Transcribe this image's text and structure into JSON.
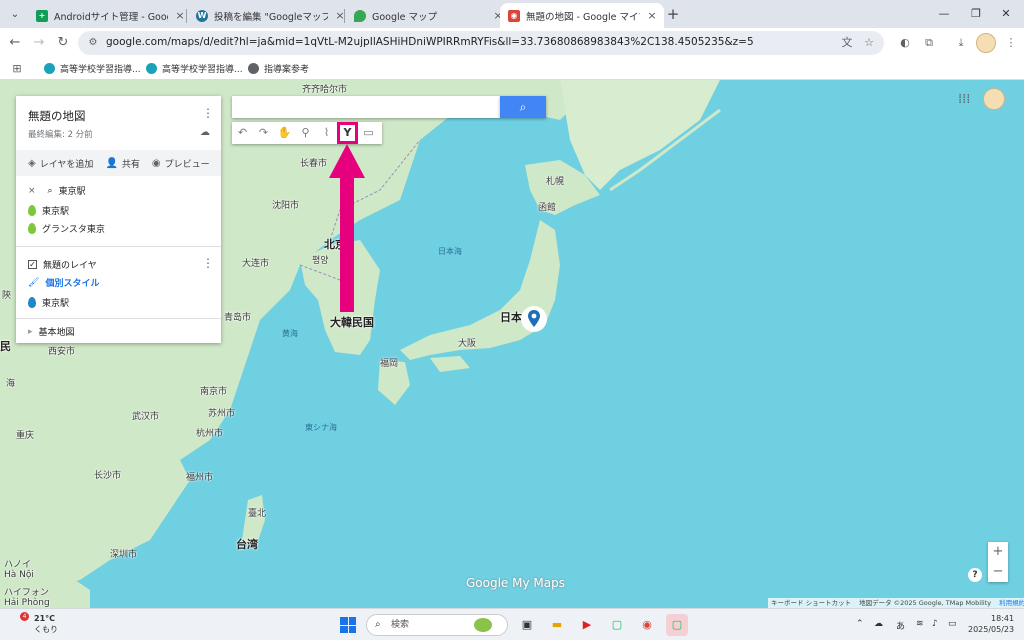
{
  "browser": {
    "tabs": [
      {
        "title": "Androidサイト管理 - Google スプ",
        "icon_color": "#0f9d58",
        "icon": "sheets-icon"
      },
      {
        "title": "投稿を編集 \"Googleマップのルート",
        "icon_color": "#21759b",
        "icon": "wordpress-icon"
      },
      {
        "title": "Google マップ",
        "icon_color": "#34a853",
        "icon": "maps-icon"
      },
      {
        "title": "無題の地図 - Google マイマップ",
        "icon_color": "#db4437",
        "icon": "mymaps-icon"
      }
    ],
    "active_tab_index": 3,
    "url": "google.com/maps/d/edit?hl=ja&mid=1qVtL-M2ujpIlASHiHDniWPIRRmRYFis&ll=33.73680868983843%2C138.4505235&z=5",
    "bookmarks": [
      "高等学校学習指導...",
      "高等学校学習指導...",
      "指導案参考"
    ]
  },
  "map_panel": {
    "title": "無題の地図",
    "subtitle": "最終編集: 2 分前",
    "actions": [
      "レイヤを追加",
      "共有",
      "プレビュー"
    ],
    "search_layer": "東京駅",
    "search_results": [
      "東京駅",
      "グランスタ東京"
    ],
    "layer_name": "無題のレイヤ",
    "style_label": "個別スタイル",
    "layer_items": [
      "東京駅"
    ],
    "base_map": "基本地図"
  },
  "map_labels": {
    "qiqihar": "齐齐哈尔市",
    "changchun": "长春市",
    "shenyang": "沈阳市",
    "dalian": "大连市",
    "beijing_partial": "北京",
    "pyongyang": "평양",
    "korea": "大韓民国",
    "qingdao": "青岛市",
    "xian": "西安市",
    "nanjing": "南京市",
    "suzhou": "苏州市",
    "wuhan": "武汉市",
    "hangzhou": "杭州市",
    "changsha": "长沙市",
    "fuzhou": "福州市",
    "taipei": "臺北",
    "taiwan": "台湾",
    "shenzhen": "深圳市",
    "hanoi": "ハノイ\nHà Nội",
    "haiphong": "ハイフォン\nHải Phòng",
    "china_partial": "民",
    "chongqing_partial": "重庆",
    "china_partial2": "陝",
    "china_partial3": "海",
    "sapporo": "札幌",
    "hakodate": "函館",
    "japan": "日本",
    "osaka": "大阪",
    "fukuoka": "福岡",
    "sea_of_japan": "日本海",
    "yellow_sea": "黄海",
    "east_china_sea": "東シナ海"
  },
  "map_footer": {
    "logo": "Google My Maps",
    "keyboard": "キーボード ショートカット",
    "attribution": "地図データ ©2025 Google, TMap Mobility",
    "terms": "利用規約"
  },
  "taskbar": {
    "weather_temp": "21°C",
    "weather_desc": "くもり",
    "weather_badge": "4",
    "search_placeholder": "検索",
    "time": "18:41",
    "date": "2025/05/23",
    "ime": "あ"
  },
  "colors": {
    "sea": "#6fd0e2",
    "land": "#cfe8c8",
    "highlight": "#e6007e",
    "accent": "#4285f4"
  }
}
